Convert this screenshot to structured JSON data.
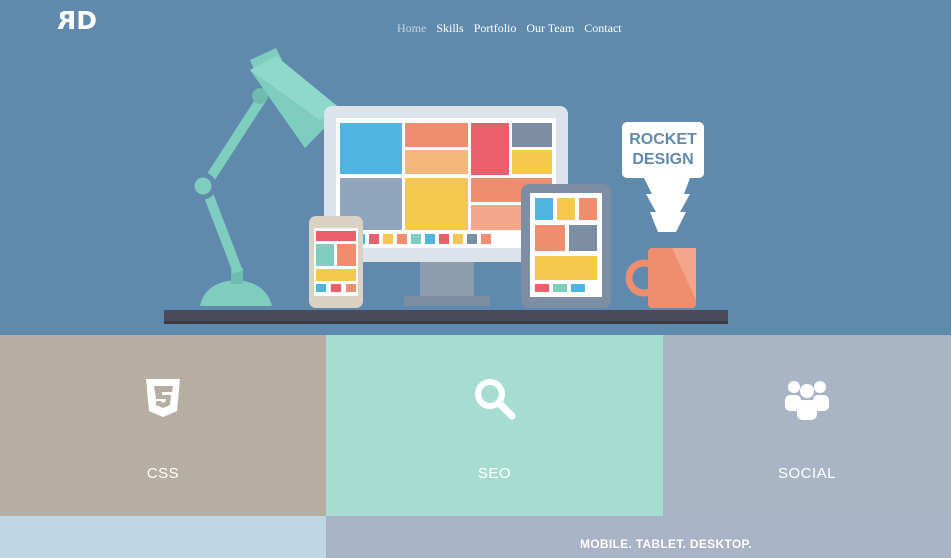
{
  "header": {
    "logo": {
      "left": "R",
      "right": "D"
    },
    "nav": [
      {
        "label": "Home",
        "active": true
      },
      {
        "label": "Skills",
        "active": false
      },
      {
        "label": "Portfolio",
        "active": false
      },
      {
        "label": "Our Team",
        "active": false
      },
      {
        "label": "Contact",
        "active": false
      }
    ]
  },
  "hero": {
    "sign_line1": "ROCKET",
    "sign_line2": "DESIGN"
  },
  "tiles": [
    {
      "label": "CSS",
      "icon": "css3-icon",
      "color": "#b7aea3"
    },
    {
      "label": "SEO",
      "icon": "search-icon",
      "color": "#a7ddd1"
    },
    {
      "label": "SOCIAL",
      "icon": "people-icon",
      "color": "#a9b5c5"
    }
  ],
  "bottom": {
    "tagline": "MOBILE. TABLET. DESKTOP."
  },
  "colors": {
    "hero_bg": "#5f89ad",
    "lamp": "#7fcdbf",
    "desk": "#4a4a58"
  }
}
